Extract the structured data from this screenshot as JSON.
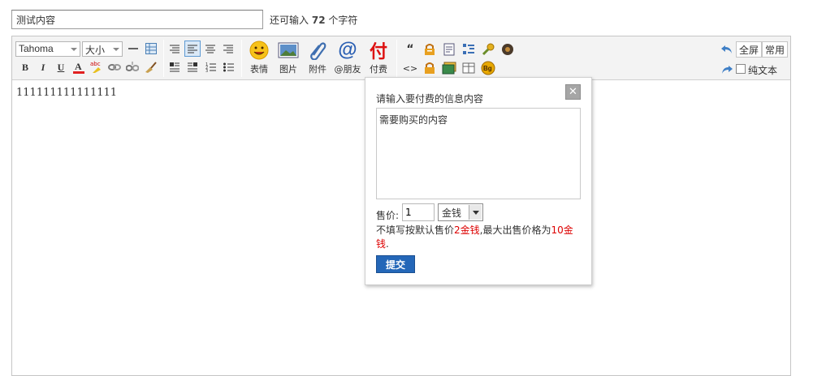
{
  "subject": {
    "value": "测试内容"
  },
  "counter": {
    "prefix": "还可输入",
    "count": "72",
    "suffix": "个字符"
  },
  "toolbar": {
    "font_family": "Tahoma",
    "font_size": "大小",
    "emoji_label": "表情",
    "image_label": "图片",
    "attach_label": "附件",
    "at_label": "@朋友",
    "pay_icon_text": "付",
    "pay_label": "付费",
    "fullscreen_label": "全屏",
    "common_label": "常用",
    "plaintext_label": "纯文本",
    "quote_glyph": "“",
    "code_glyph": "<>",
    "bg_glyph": "Bg"
  },
  "editor": {
    "content": "111111111111111"
  },
  "popup": {
    "title": "请输入要付费的信息内容",
    "close": "✕",
    "content": "需要购买的内容",
    "price_label": "售价:",
    "price_value": "1",
    "currency": "金钱",
    "note_a": "不填写按默认售价",
    "note_b": "2金钱",
    "note_c": ",最大出售价格为",
    "note_d": "10金钱",
    "note_e": ".",
    "submit": "提交"
  }
}
